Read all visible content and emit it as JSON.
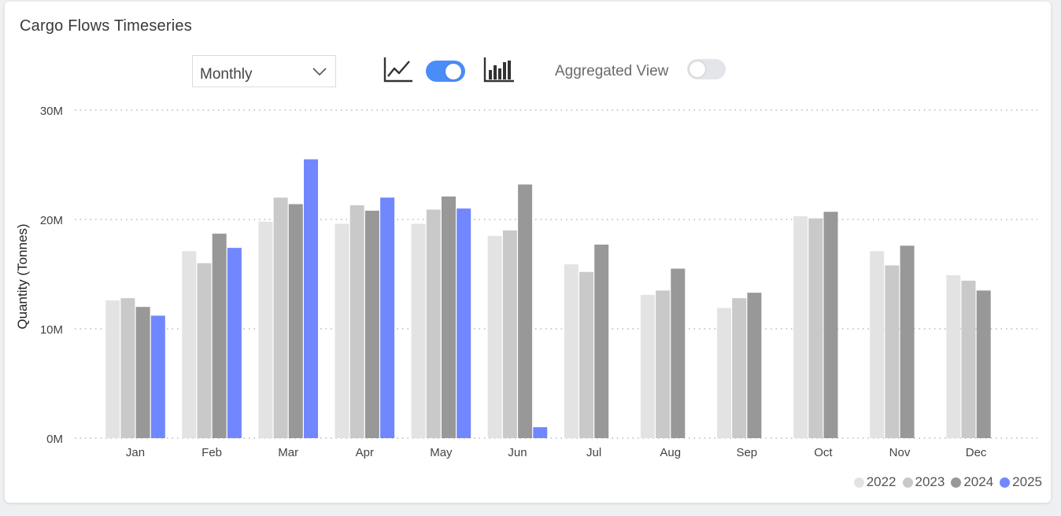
{
  "panel": {
    "title": "Cargo Flows Timeseries"
  },
  "controls": {
    "period_dropdown": {
      "selected": "Monthly",
      "icon": "chevron-down-icon"
    },
    "line_chart_icon": "line-chart-icon",
    "chart_type_toggle": {
      "on": true,
      "color": "#4b8df8"
    },
    "bar_chart_icon": "bar-chart-icon",
    "aggregated_view": {
      "label": "Aggregated View",
      "on": false
    }
  },
  "colors": {
    "2022": "#e3e3e3",
    "2023": "#c9c9c9",
    "2024": "#989898",
    "2025": "#7187ff",
    "gridline": "#b8b8b8",
    "axis_text": "#444444"
  },
  "chart_data": {
    "type": "bar",
    "ylabel": "Quantity (Tonnes)",
    "xlabel": "",
    "ylim": [
      0,
      30000000
    ],
    "yticks": [
      0,
      10000000,
      20000000,
      30000000
    ],
    "ytick_labels": [
      "0M",
      "10M",
      "20M",
      "30M"
    ],
    "grid": "horizontal dotted",
    "legend_position": "bottom-right",
    "categories": [
      "Jan",
      "Feb",
      "Mar",
      "Apr",
      "May",
      "Jun",
      "Jul",
      "Aug",
      "Sep",
      "Oct",
      "Nov",
      "Dec"
    ],
    "series": [
      {
        "name": "2022",
        "values": [
          12.6,
          17.1,
          19.8,
          19.6,
          19.6,
          18.5,
          15.9,
          13.1,
          11.9,
          20.3,
          17.1,
          14.9
        ]
      },
      {
        "name": "2023",
        "values": [
          12.8,
          16.0,
          22.0,
          21.3,
          20.9,
          19.0,
          15.2,
          13.5,
          12.8,
          20.1,
          15.8,
          14.4
        ]
      },
      {
        "name": "2024",
        "values": [
          12.0,
          18.7,
          21.4,
          20.8,
          22.1,
          23.2,
          17.7,
          15.5,
          13.3,
          20.7,
          17.6,
          13.5
        ]
      },
      {
        "name": "2025",
        "values": [
          11.2,
          17.4,
          25.5,
          22.0,
          21.0,
          1.0,
          null,
          null,
          null,
          null,
          null,
          null
        ]
      }
    ],
    "value_unit_scale": "millions"
  }
}
